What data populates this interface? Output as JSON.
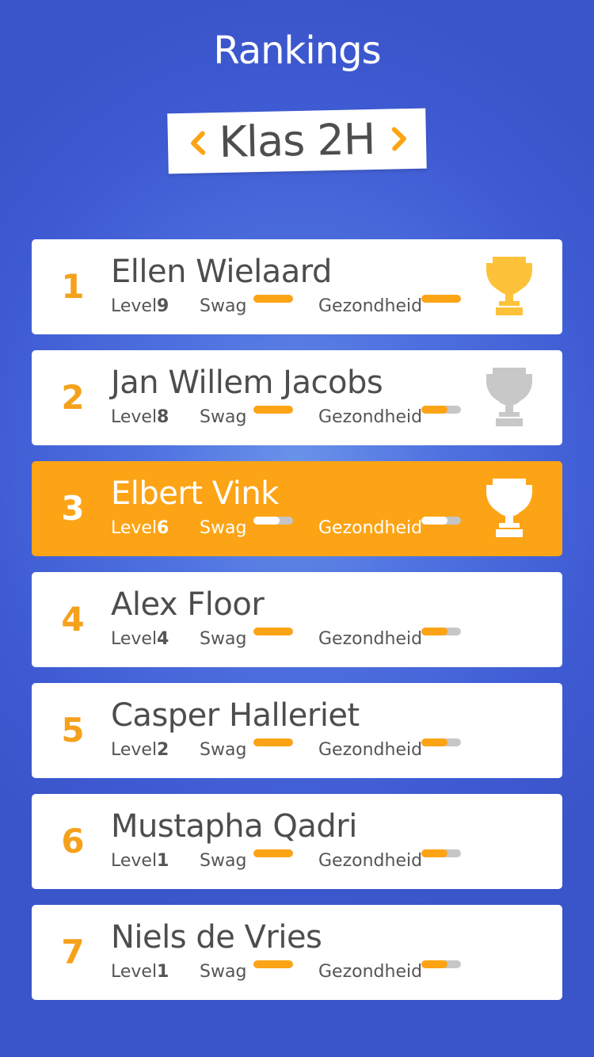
{
  "header": {
    "title": "Rankings"
  },
  "class_selector": {
    "name": "Klas 2H",
    "prev_icon": "chevron-left-icon",
    "next_icon": "chevron-right-icon"
  },
  "labels": {
    "level": "Level",
    "swag": "Swag",
    "health": "Gezondheid"
  },
  "colors": {
    "accent": "#fca415",
    "gold": "#fdc23a",
    "silver": "#c8c8c8",
    "bronze_on_accent": "#ffffff",
    "background": "#4f72e0"
  },
  "rankings": [
    {
      "rank": "1",
      "name": "Ellen Wielaard",
      "level": "9",
      "swag": 1.0,
      "health": 1.0,
      "trophy": "gold",
      "active": false
    },
    {
      "rank": "2",
      "name": "Jan Willem Jacobs",
      "level": "8",
      "swag": 1.0,
      "health": 0.65,
      "trophy": "silver",
      "active": false
    },
    {
      "rank": "3",
      "name": "Elbert Vink",
      "level": "6",
      "swag": 0.65,
      "health": 0.65,
      "trophy": "bronze",
      "active": true
    },
    {
      "rank": "4",
      "name": "Alex Floor",
      "level": "4",
      "swag": 1.0,
      "health": 0.65,
      "trophy": null,
      "active": false
    },
    {
      "rank": "5",
      "name": "Casper Halleriet",
      "level": "2",
      "swag": 1.0,
      "health": 0.65,
      "trophy": null,
      "active": false
    },
    {
      "rank": "6",
      "name": "Mustapha Qadri",
      "level": "1",
      "swag": 1.0,
      "health": 0.65,
      "trophy": null,
      "active": false
    },
    {
      "rank": "7",
      "name": "Niels de Vries",
      "level": "1",
      "swag": 1.0,
      "health": 0.65,
      "trophy": null,
      "active": false
    }
  ]
}
